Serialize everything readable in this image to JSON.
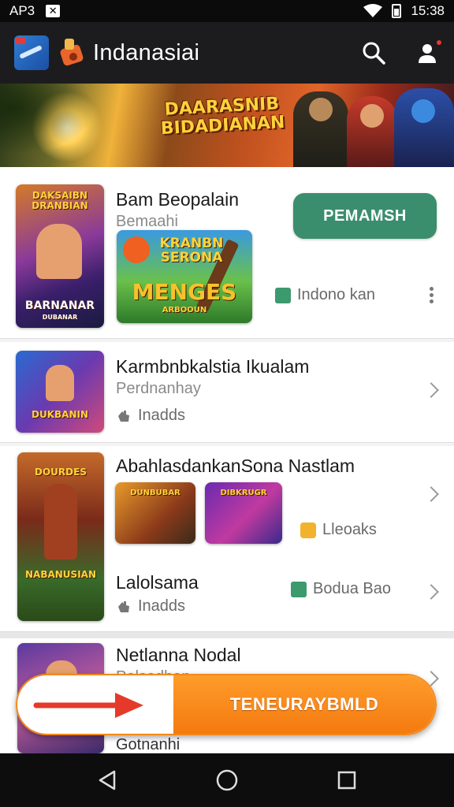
{
  "status_bar": {
    "left_text": "AP3",
    "time": "15:38"
  },
  "app_bar": {
    "title": "Indanasiai"
  },
  "banner": {
    "title": "DAARASNIB BIDADIANAN"
  },
  "featured": {
    "title": "Bam Beopalain",
    "subtitle": "Bemaahi",
    "button_label": "PEMAMSH",
    "tag": "Indono kan",
    "thumb_main_label_top": "DAKSAIBN DRANBIAN",
    "thumb_main_label_bottom": "BARNANAR",
    "thumb_main_label_tiny": "DUBANAR",
    "thumb_promo_label_top": "KRANBN SERONA",
    "thumb_promo_label_mid": "MENGES",
    "thumb_promo_label_bottom": "ARBOOUN"
  },
  "items": [
    {
      "title": "Karmbnbkalstia Ikualam",
      "subtitle": "Perdnanhay",
      "meta": "Inadds",
      "thumb_label": "DUKBANIN"
    },
    {
      "title": "AbahlasdankanSona Nastlam",
      "tag": "Lleoaks",
      "thumb_label_top": "DOURDES",
      "thumb_label_bottom": "NABANUSIAN",
      "mini1_label": "DUNBUBAR",
      "mini2_label": "DIBKRUGR"
    },
    {
      "title": "Lalolsama",
      "tag": "Bodua Bao",
      "meta": "Inadds"
    },
    {
      "title": "Netlanna Nodal",
      "subtitle": "Pelsodhan"
    },
    {
      "title": "Gotnanhi"
    }
  ],
  "float_action": {
    "label": "TENEURAYBMLD"
  },
  "colors": {
    "accent_green": "#3a8e6e",
    "accent_orange": "#f47a10",
    "app_bar": "#1c1c1e"
  }
}
